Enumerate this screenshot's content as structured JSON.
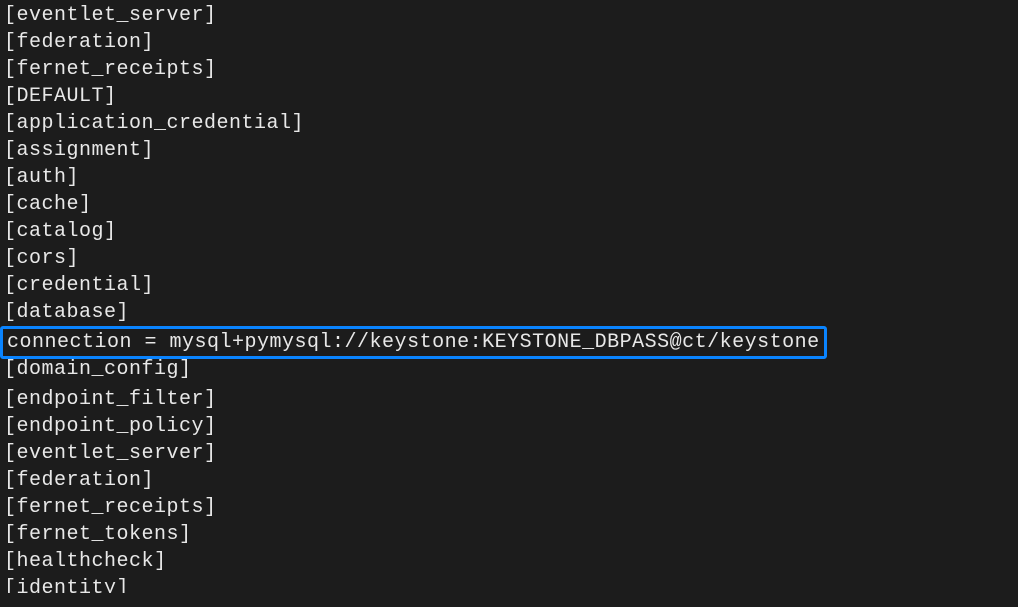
{
  "lines": [
    "[eventlet_server]",
    "[federation]",
    "[fernet_receipts]",
    "[DEFAULT]",
    "[application_credential]",
    "[assignment]",
    "[auth]",
    "[cache]",
    "[catalog]",
    "[cors]",
    "[credential]",
    "[database]"
  ],
  "highlighted_line": "connection = mysql+pymysql://keystone:KEYSTONE_DBPASS@ct/keystone",
  "lines_after": [
    "[domain_config]",
    "[endpoint_filter]",
    "[endpoint_policy]",
    "[eventlet_server]",
    "[federation]",
    "[fernet_receipts]",
    "[fernet_tokens]",
    "[healthcheck]",
    "[identity]"
  ]
}
